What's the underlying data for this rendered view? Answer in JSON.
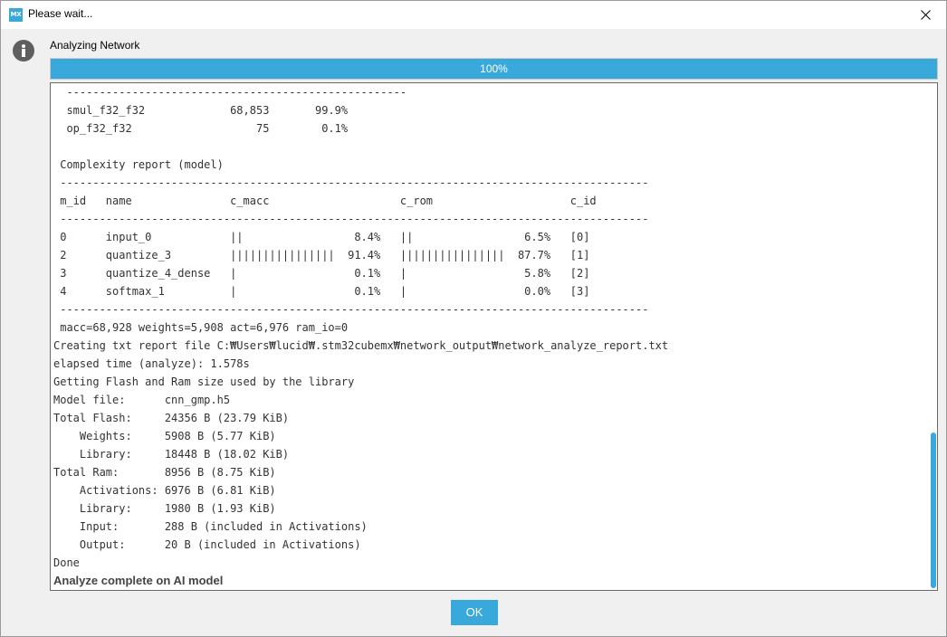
{
  "window": {
    "title": "Please wait...",
    "logo_text": "MX"
  },
  "status": {
    "label": "Analyzing Network",
    "progress_text": "100%",
    "progress_value": 100
  },
  "console": {
    "lines": [
      "  ----------------------------------------------------",
      "  smul_f32_f32             68,853       99.9%",
      "  op_f32_f32                   75        0.1%",
      "",
      " Complexity report (model)",
      " ------------------------------------------------------------------------------------------",
      " m_id   name               c_macc                    c_rom                     c_id",
      " ------------------------------------------------------------------------------------------",
      " 0      input_0            ||                 8.4%   ||                 6.5%   [0]",
      " 2      quantize_3         ||||||||||||||||  91.4%   ||||||||||||||||  87.7%   [1]",
      " 3      quantize_4_dense   |                  0.1%   |                  5.8%   [2]",
      " 4      softmax_1          |                  0.1%   |                  0.0%   [3]",
      " ------------------------------------------------------------------------------------------",
      " macc=68,928 weights=5,908 act=6,976 ram_io=0",
      "Creating txt report file C:₩Users₩lucid₩.stm32cubemx₩network_output₩network_analyze_report.txt",
      "elapsed time (analyze): 1.578s",
      "Getting Flash and Ram size used by the library",
      "Model file:      cnn_gmp.h5",
      "Total Flash:     24356 B (23.79 KiB)",
      "    Weights:     5908 B (5.77 KiB)",
      "    Library:     18448 B (18.02 KiB)",
      "Total Ram:       8956 B (8.75 KiB)",
      "    Activations: 6976 B (6.81 KiB)",
      "    Library:     1980 B (1.93 KiB)",
      "    Input:       288 B (included in Activations)",
      "    Output:      20 B (included in Activations)",
      "Done"
    ],
    "final_message": "Analyze complete on AI model"
  },
  "buttons": {
    "ok_label": "OK"
  },
  "icons": {
    "logo": "mx-logo-icon",
    "close": "close-icon",
    "info": "info-icon"
  },
  "colors": {
    "accent": "#39a9dc",
    "window_bg": "#f0f0f0",
    "console_text": "#333333",
    "info_icon": "#5f5f5f"
  }
}
